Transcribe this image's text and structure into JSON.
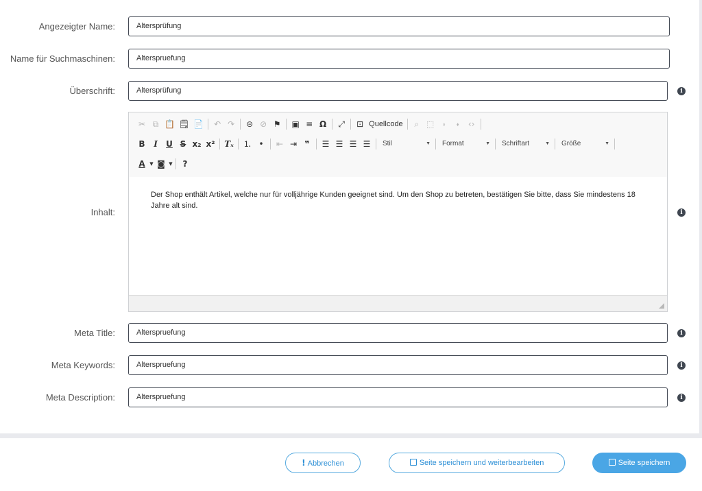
{
  "fields": {
    "display_name": {
      "label": "Angezeigter Name:",
      "value": "Altersprüfung"
    },
    "seo_name": {
      "label": "Name für Suchmaschinen:",
      "value": "Alterspruefung"
    },
    "heading": {
      "label": "Überschrift:",
      "value": "Altersprüfung"
    },
    "content": {
      "label": "Inhalt:",
      "value": "Der Shop enthält Artikel, welche nur für volljährige Kunden geeignet sind. Um den Shop zu betreten, bestätigen Sie bitte, dass Sie mindestens 18 Jahre alt sind."
    },
    "meta_title": {
      "label": "Meta Title:",
      "value": "Alterspruefung"
    },
    "meta_keywords": {
      "label": "Meta Keywords:",
      "value": "Alterspruefung"
    },
    "meta_description": {
      "label": "Meta Description:",
      "value": "Alterspruefung"
    }
  },
  "editor": {
    "source_label": "Quellcode",
    "combos": {
      "style": "Stil",
      "format": "Format",
      "font": "Schriftart",
      "size": "Größe"
    }
  },
  "footer": {
    "cancel_label": "Abbrechen",
    "save_continue_label": "Seite speichern und weiterbearbeiten",
    "save_label": "Seite speichern"
  },
  "colors": {
    "accent": "#4aa6e5",
    "info_icon": "#3f4650"
  }
}
